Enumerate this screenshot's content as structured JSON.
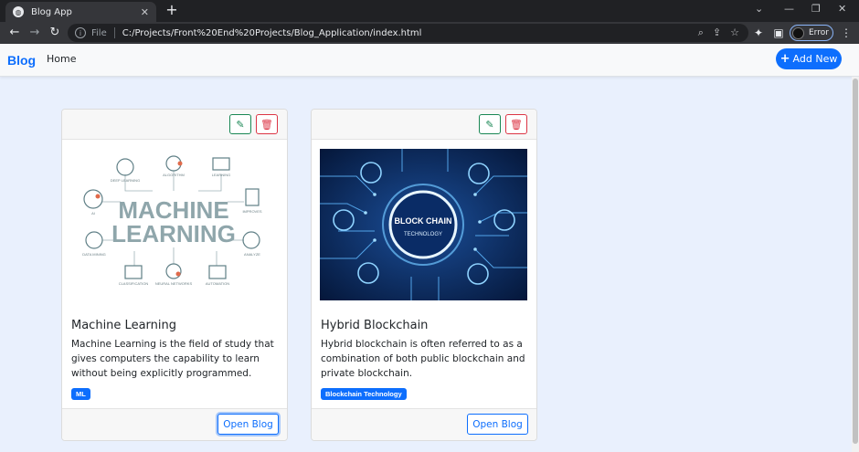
{
  "browser": {
    "tab_title": "Blog App",
    "tab_close": "✕",
    "new_tab": "+",
    "file_label": "File",
    "url": "C:/Projects/Front%20End%20Projects/Blog_Application/index.html",
    "profile_label": "Error"
  },
  "navbar": {
    "brand": "Blog",
    "home": "Home",
    "add_new": "Add New"
  },
  "cards": [
    {
      "title": "Machine Learning",
      "text": "Machine Learning is the field of study that gives computers the capability to learn without being explicitly programmed.",
      "badge": "ML",
      "open_label": "Open Blog",
      "image_words": [
        "MACHINE",
        "LEARNING"
      ],
      "image_labels": [
        "DEEP LEARNING",
        "ALGORITHM",
        "LEARNING",
        "AI",
        "IMPROVES",
        "DATA MINING",
        "CLASSIFICATION",
        "NEURAL NETWORKS",
        "AUTOMATION",
        "ANALYZE"
      ]
    },
    {
      "title": "Hybrid Blockchain",
      "text": "Hybrid blockchain is often referred to as a combination of both public blockchain and private blockchain.",
      "badge": "Blockchain Technology",
      "open_label": "Open Blog",
      "image_words": [
        "BLOCK CHAIN",
        "TECHNOLOGY"
      ]
    }
  ],
  "colors": {
    "primary": "#0d6efd",
    "success": "#198754",
    "danger": "#dc3545",
    "page_bg": "#e9f0fd"
  }
}
